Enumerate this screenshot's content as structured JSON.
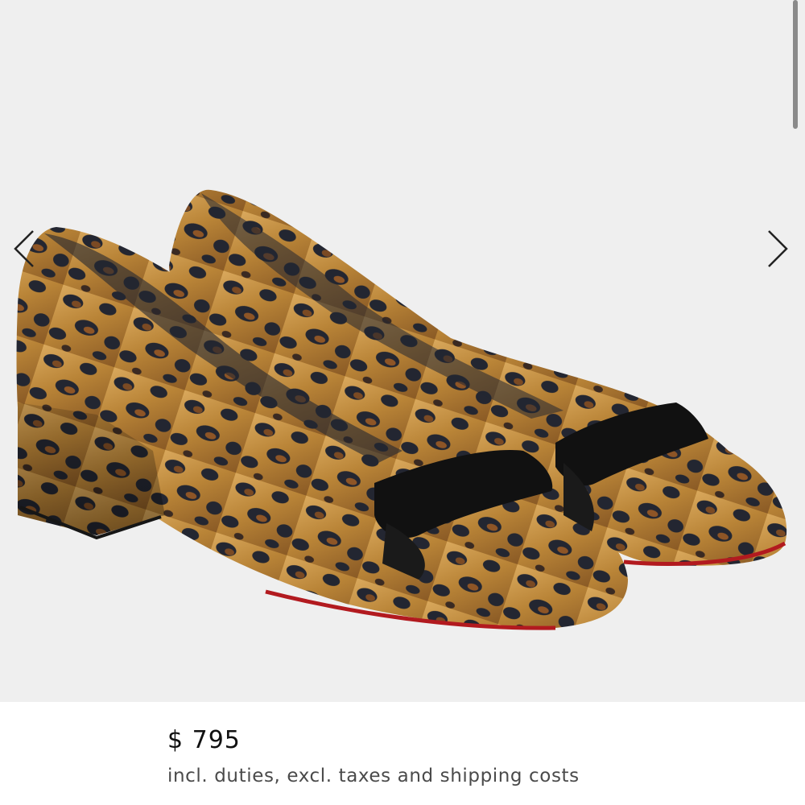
{
  "gallery": {
    "image_alt": "Leopard print pumps with black bow",
    "prev_icon": "chevron-left-icon",
    "next_icon": "chevron-right-icon"
  },
  "product": {
    "price": "$ 795",
    "price_note": "incl. duties, excl. taxes and shipping costs"
  },
  "colors": {
    "background": "#efefef",
    "leopard_gold": "#b98437",
    "leopard_spot": "#232631",
    "bow": "#111111",
    "sole_red": "#b21a1f"
  }
}
